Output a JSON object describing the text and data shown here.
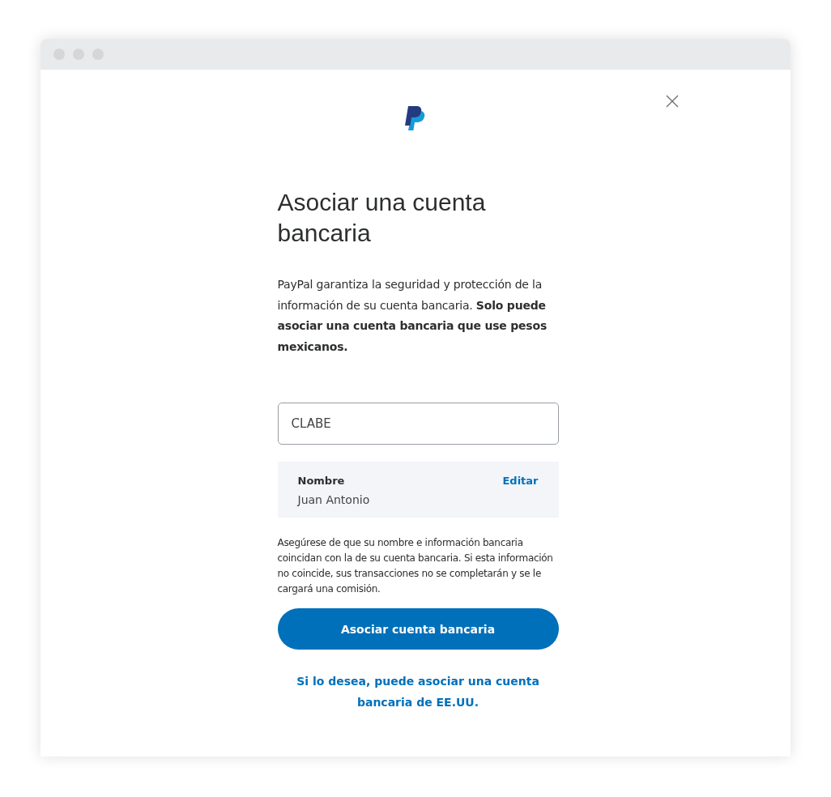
{
  "dialog": {
    "heading": "Asociar una cuenta bancaria",
    "intro": "PayPal garantiza la seguridad y protección de la información de su cuenta bancaria. **Solo puede asociar una cuenta bancaria que use pesos mexicanos.**",
    "clabe_field": {
      "placeholder": "CLABE"
    },
    "name_card": {
      "label": "Nombre",
      "value": "Juan Antonio",
      "action": "Editar"
    },
    "notice": "Asegúrese de que su nombre e información bancaria coincidan con la de su cuenta bancaria. Si esta información no coincide, sus transacciones no se completarán y se le cargará una comisión.",
    "primary_button": "Asociar cuenta bancaria",
    "link": "Si lo desea, puede asociar una cuenta bancaria de EE.UU."
  }
}
